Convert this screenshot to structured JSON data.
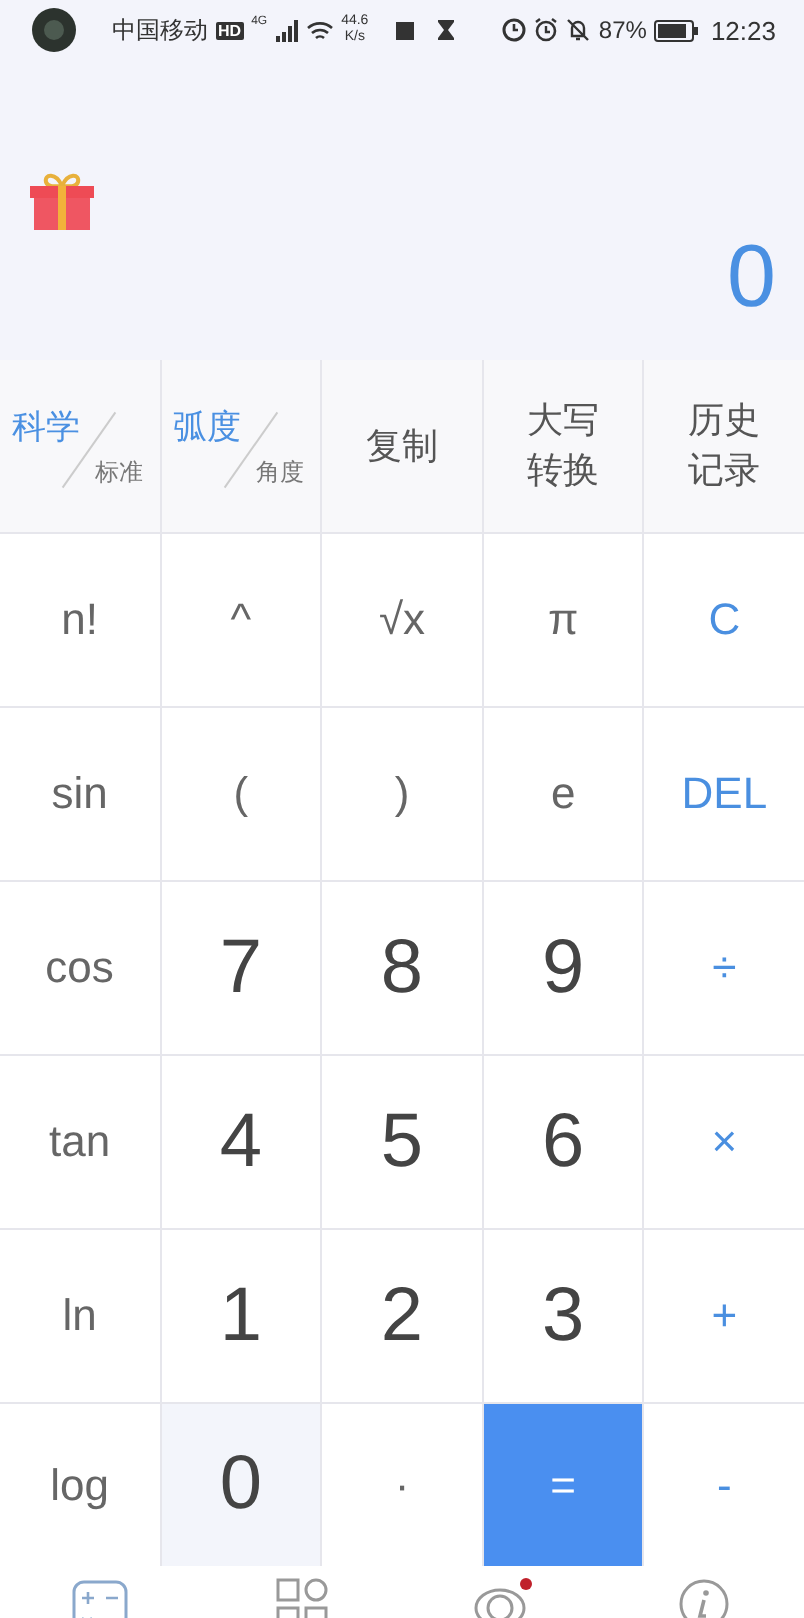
{
  "status_bar": {
    "carrier": "中国移动",
    "hd": "HD",
    "network": "4G",
    "speed": "44.6",
    "speed_unit": "K/s",
    "battery": "87%",
    "time": "12:23"
  },
  "display": {
    "value": "0"
  },
  "mode_row": [
    {
      "kind": "toggle",
      "main": "科学",
      "sub": "标准"
    },
    {
      "kind": "toggle",
      "main": "弧度",
      "sub": "角度"
    },
    {
      "kind": "text",
      "lines": [
        "复制"
      ]
    },
    {
      "kind": "text",
      "lines": [
        "大写",
        "转换"
      ]
    },
    {
      "kind": "text",
      "lines": [
        "历史",
        "记录"
      ]
    }
  ],
  "keys": [
    {
      "label": "n!",
      "kind": "func"
    },
    {
      "label": "^",
      "kind": "func"
    },
    {
      "label": "√x",
      "kind": "func"
    },
    {
      "label": "π",
      "kind": "func"
    },
    {
      "label": "C",
      "kind": "op"
    },
    {
      "label": "sin",
      "kind": "func"
    },
    {
      "label": "(",
      "kind": "func"
    },
    {
      "label": ")",
      "kind": "func"
    },
    {
      "label": "e",
      "kind": "func"
    },
    {
      "label": "DEL",
      "kind": "op"
    },
    {
      "label": "cos",
      "kind": "func"
    },
    {
      "label": "7",
      "kind": "digit"
    },
    {
      "label": "8",
      "kind": "digit"
    },
    {
      "label": "9",
      "kind": "digit"
    },
    {
      "label": "÷",
      "kind": "op"
    },
    {
      "label": "tan",
      "kind": "func"
    },
    {
      "label": "4",
      "kind": "digit"
    },
    {
      "label": "5",
      "kind": "digit"
    },
    {
      "label": "6",
      "kind": "digit"
    },
    {
      "label": "×",
      "kind": "op"
    },
    {
      "label": "ln",
      "kind": "func"
    },
    {
      "label": "1",
      "kind": "digit"
    },
    {
      "label": "2",
      "kind": "digit"
    },
    {
      "label": "3",
      "kind": "digit"
    },
    {
      "label": "+",
      "kind": "op"
    },
    {
      "label": "log",
      "kind": "func"
    },
    {
      "label": "0",
      "kind": "digit-shaded"
    },
    {
      "label": "·",
      "kind": "func"
    },
    {
      "label": "=",
      "kind": "equals"
    },
    {
      "label": "-",
      "kind": "op"
    }
  ],
  "bottom_nav": [
    {
      "kind": "calculator",
      "selected": true,
      "badge": false
    },
    {
      "kind": "grid",
      "selected": false,
      "badge": false
    },
    {
      "kind": "rings",
      "selected": false,
      "badge": true
    },
    {
      "kind": "info",
      "selected": false,
      "badge": false
    }
  ]
}
